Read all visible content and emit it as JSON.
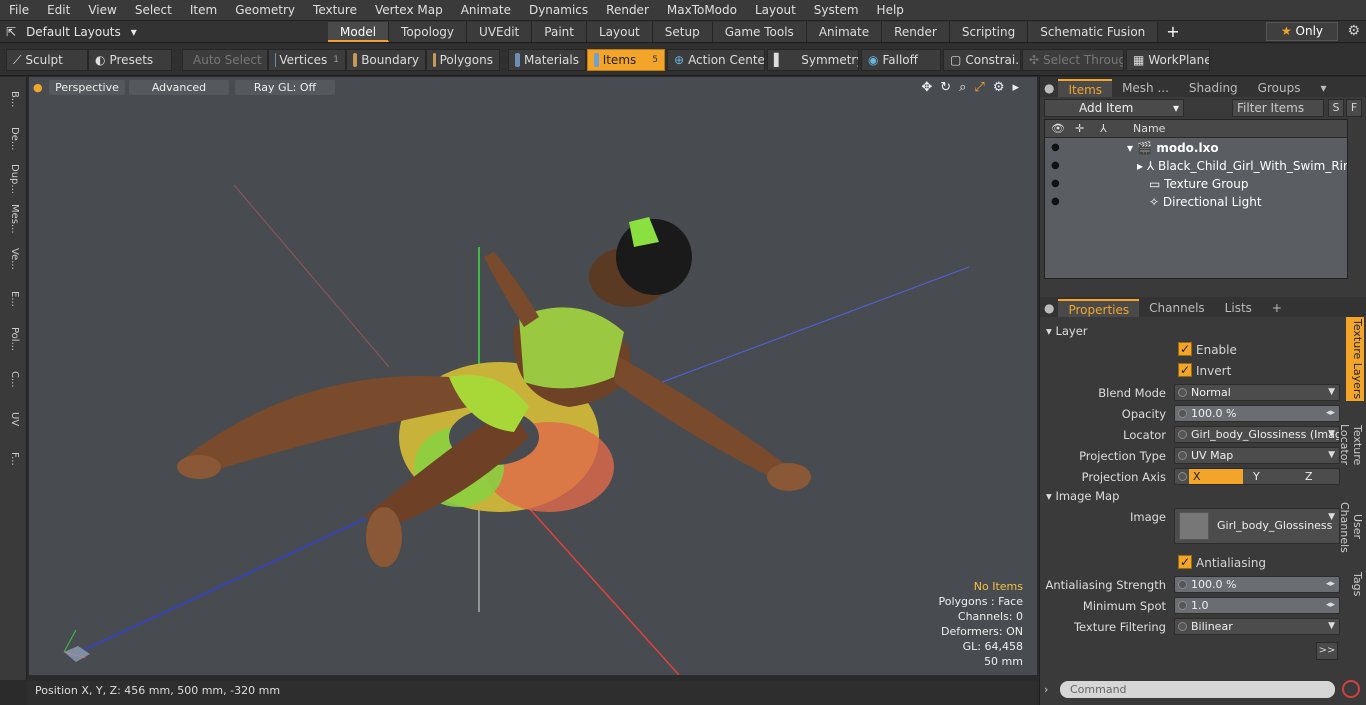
{
  "menu": [
    "File",
    "Edit",
    "View",
    "Select",
    "Item",
    "Geometry",
    "Texture",
    "Vertex Map",
    "Animate",
    "Dynamics",
    "Render",
    "MaxToModo",
    "Layout",
    "System",
    "Help"
  ],
  "layouts": "Default Layouts",
  "tabs": [
    "Model",
    "Topology",
    "UVEdit",
    "Paint",
    "Layout",
    "Setup",
    "Game Tools",
    "Animate",
    "Render",
    "Scripting",
    "Schematic Fusion"
  ],
  "only": "Only",
  "toolbar": {
    "sculpt": "Sculpt",
    "presets": "Presets",
    "auto_select": "Auto Select",
    "vertices": "Vertices",
    "vertices_count": "1",
    "boundary": "Boundary",
    "polygons": "Polygons",
    "materials": "Materials",
    "items": "Items",
    "items_count": "5",
    "action_center": "Action Center",
    "symmetry": "Symmetry",
    "falloff": "Falloff",
    "constraints": "Constrai...",
    "select_through": "Select Through",
    "workplane": "WorkPlane"
  },
  "left_strip": [
    "B...",
    "De...",
    "Dup...",
    "Mes...",
    "Ve...",
    "E...",
    "Pol...",
    "C...",
    "UV",
    "F..."
  ],
  "viewport": {
    "perspective": "Perspective",
    "advanced": "Advanced",
    "raygl": "Ray GL: Off"
  },
  "stats": {
    "no_items": "No Items",
    "polygons": "Polygons : Face",
    "channels": "Channels: 0",
    "deformers": "Deformers: ON",
    "gl": "GL: 64,458",
    "scale": "50 mm"
  },
  "status": "Position X, Y, Z:  456 mm, 500 mm, -320 mm",
  "items_panel": {
    "tabs": [
      "Items",
      "Mesh ...",
      "Shading",
      "Groups"
    ],
    "add_item": "Add Item",
    "filter": "Filter Items",
    "s": "S",
    "f": "F",
    "name_col": "Name",
    "rows": [
      "modo.lxo",
      "Black_Child_Girl_With_Swim_Ring ...",
      "Texture Group",
      "Directional Light"
    ]
  },
  "props_panel": {
    "tabs": [
      "Properties",
      "Channels",
      "Lists"
    ],
    "layer": "Layer",
    "enable": "Enable",
    "invert": "Invert",
    "blend_mode_label": "Blend Mode",
    "blend_mode": "Normal",
    "opacity_label": "Opacity",
    "opacity": "100.0 %",
    "locator_label": "Locator",
    "locator": "Girl_body_Glossiness (Image) ( ...",
    "proj_type_label": "Projection Type",
    "proj_type": "UV Map",
    "proj_axis_label": "Projection Axis",
    "axis_x": "X",
    "axis_y": "Y",
    "axis_z": "Z",
    "image_map": "Image Map",
    "image_label": "Image",
    "image": "Girl_body_Glossiness",
    "antialiasing": "Antialiasing",
    "aa_strength_label": "Antialiasing Strength",
    "aa_strength": "100.0 %",
    "min_spot_label": "Minimum Spot",
    "min_spot": "1.0",
    "tex_filter_label": "Texture Filtering",
    "tex_filter": "Bilinear",
    "more": ">>",
    "vtabs": [
      "Texture Layers",
      "Texture Locator",
      "User Channels",
      "Tags"
    ]
  },
  "command_placeholder": "Command"
}
